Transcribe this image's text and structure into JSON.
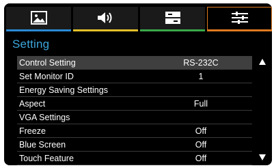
{
  "menu": {
    "tabs": [
      {
        "icon": "picture-icon",
        "accent": "#2a8ad4"
      },
      {
        "icon": "speaker-icon",
        "accent": "#e3c12a"
      },
      {
        "icon": "panel-icon",
        "accent": "#3aa84b"
      },
      {
        "icon": "sliders-icon",
        "accent": "#e07a1f",
        "active": true
      }
    ],
    "title": "Setting",
    "items": [
      {
        "label": "Control Setting",
        "value": "RS-232C"
      },
      {
        "label": "Set Monitor ID",
        "value": "1"
      },
      {
        "label": "Energy Saving Settings",
        "value": ""
      },
      {
        "label": "Aspect",
        "value": "Full"
      },
      {
        "label": "VGA Settings",
        "value": ""
      },
      {
        "label": "Freeze",
        "value": "Off"
      },
      {
        "label": "Blue Screen",
        "value": "Off"
      },
      {
        "label": "Touch Feature",
        "value": "Off"
      }
    ]
  }
}
